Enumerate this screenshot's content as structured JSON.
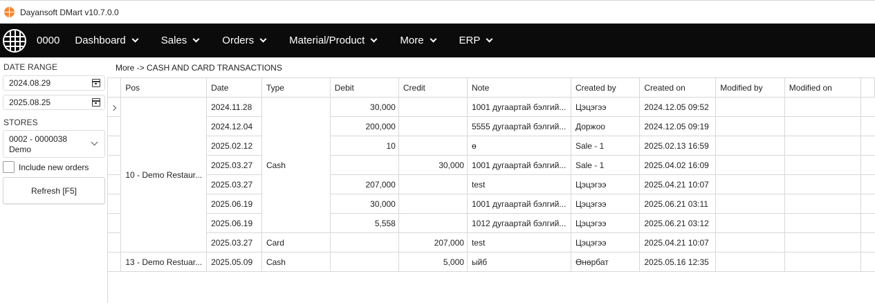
{
  "window": {
    "title": "Dayansoft DMart v10.7.0.0"
  },
  "menubar": {
    "store_code": "0000",
    "items": [
      {
        "label": "Dashboard"
      },
      {
        "label": "Sales"
      },
      {
        "label": "Orders"
      },
      {
        "label": "Material/Product"
      },
      {
        "label": "More"
      },
      {
        "label": "ERP"
      }
    ]
  },
  "filters": {
    "date_range_label": "DATE RANGE",
    "date_from": "2024.08.29",
    "date_to": "2025.08.25",
    "stores_label": "STORES",
    "store_line1": "0002 - 0000038",
    "store_line2": "Demo",
    "include_new_orders_label": "Include new orders",
    "refresh_label": "Refresh [F5]"
  },
  "breadcrumb": "More -> CASH AND CARD TRANSACTIONS",
  "grid": {
    "columns": [
      "Pos",
      "Date",
      "Type",
      "Debit",
      "Credit",
      "Note",
      "Created by",
      "Created on",
      "Modified by",
      "Modified on"
    ],
    "groups": [
      {
        "pos": "10 - Demo Restaur...",
        "types": [
          {
            "type": "Cash",
            "rows": [
              {
                "date": "2024.11.28",
                "debit": "30,000",
                "credit": "",
                "note": "1001 дугаартай бэлгий...",
                "created_by": "Цэцэгээ",
                "created_on": "2024.12.05 09:52"
              },
              {
                "date": "2024.12.04",
                "debit": "200,000",
                "credit": "",
                "note": "5555 дугаартай бэлгий...",
                "created_by": "Доржоо",
                "created_on": "2024.12.05 09:19"
              },
              {
                "date": "2025.02.12",
                "debit": "10",
                "credit": "",
                "note": "ө",
                "created_by": "Sale - 1",
                "created_on": "2025.02.13 16:59"
              },
              {
                "date": "2025.03.27",
                "debit": "",
                "credit": "30,000",
                "note": "1001 дугаартай бэлгий...",
                "created_by": "Sale - 1",
                "created_on": "2025.04.02 16:09"
              },
              {
                "date": "2025.03.27",
                "debit": "207,000",
                "credit": "",
                "note": "test",
                "created_by": "Цэцэгээ",
                "created_on": "2025.04.21 10:07"
              },
              {
                "date": "2025.06.19",
                "debit": "30,000",
                "credit": "",
                "note": "1001 дугаартай бэлгий...",
                "created_by": "Цэцэгээ",
                "created_on": "2025.06.21 03:11"
              },
              {
                "date": "2025.06.19",
                "debit": "5,558",
                "credit": "",
                "note": "1012 дугаартай бэлгий...",
                "created_by": "Цэцэгээ",
                "created_on": "2025.06.21 03:12"
              }
            ]
          },
          {
            "type": "Card",
            "rows": [
              {
                "date": "2025.03.27",
                "debit": "",
                "credit": "207,000",
                "note": "test",
                "created_by": "Цэцэгээ",
                "created_on": "2025.04.21 10:07"
              }
            ]
          }
        ]
      },
      {
        "pos": "13 - Demo Restuar...",
        "types": [
          {
            "type": "Cash",
            "rows": [
              {
                "date": "2025.05.09",
                "debit": "",
                "credit": "5,000",
                "note": "ыйб",
                "created_by": "Өнөрбат",
                "created_on": "2025.05.16 12:35"
              }
            ]
          }
        ]
      }
    ]
  }
}
